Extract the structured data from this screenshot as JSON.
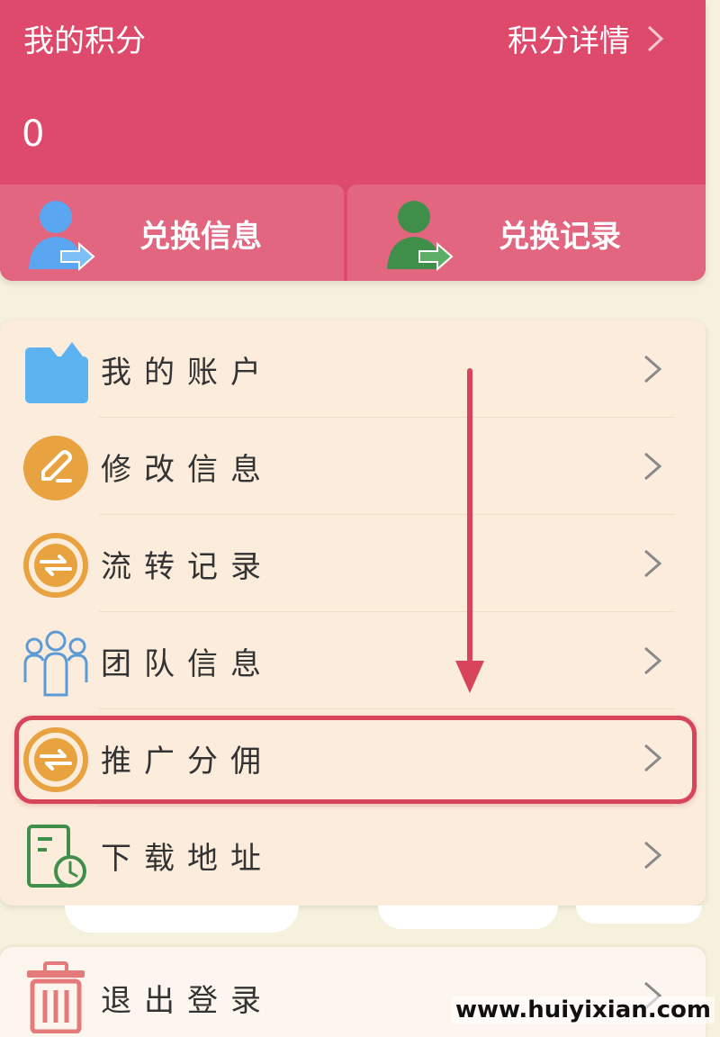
{
  "points": {
    "title": "我的积分",
    "detail_label": "积分详情",
    "value": "0",
    "exchange_info_label": "兑换信息",
    "exchange_record_label": "兑换记录"
  },
  "menu": {
    "items": [
      {
        "label": "我的账户",
        "icon": "folder-icon"
      },
      {
        "label": "修改信息",
        "icon": "edit-icon"
      },
      {
        "label": "流转记录",
        "icon": "exchange-icon"
      },
      {
        "label": "团队信息",
        "icon": "team-icon"
      },
      {
        "label": "推广分佣",
        "icon": "exchange-icon"
      },
      {
        "label": "下载地址",
        "icon": "document-clock-icon"
      }
    ],
    "highlighted_item": "推广分佣"
  },
  "logout": {
    "label": "退出登录",
    "icon": "trash-icon"
  },
  "watermark": "www.huiyixian.com",
  "colors": {
    "header_bg": "#dd4a6c",
    "highlight": "#d8455b",
    "menu_bg": "#fbecdc",
    "orange_icon": "#e8a23f",
    "blue_icon": "#5cb3f0",
    "green_icon": "#3f8f4a"
  }
}
